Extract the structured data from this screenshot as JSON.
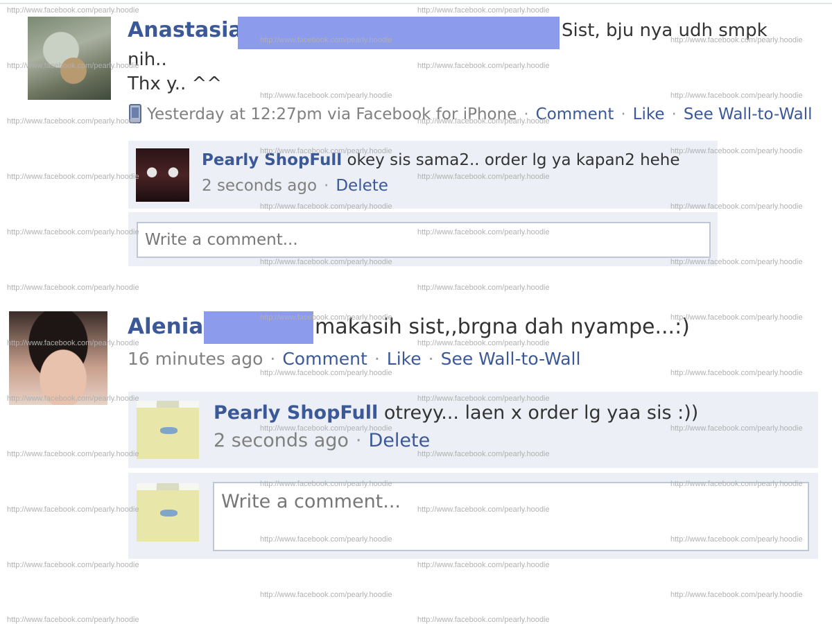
{
  "posts": [
    {
      "author": "Anastasia",
      "text_line1": "Sist, bju nya udh smpk",
      "text_line2": "nih..",
      "text_line3": "Thx y.. ^^",
      "meta": {
        "time": "Yesterday at 12:27pm via Facebook for iPhone",
        "comment": "Comment",
        "like": "Like",
        "wall": "See Wall-to-Wall"
      },
      "reply": {
        "name": "Pearly ShopFull",
        "text": "okey sis sama2.. order lg ya kapan2 hehe",
        "time": "2 seconds ago",
        "delete": "Delete"
      },
      "comment_placeholder": "Write a comment..."
    },
    {
      "author": "Alenia",
      "text_line1": "makasih sist,,brgna dah nyampe...:)",
      "meta": {
        "time": "16 minutes ago",
        "comment": "Comment",
        "like": "Like",
        "wall": "See Wall-to-Wall"
      },
      "reply": {
        "name": "Pearly ShopFull",
        "text": "otreyy... laen x order lg yaa sis :))",
        "time": "2 seconds ago",
        "delete": "Delete"
      },
      "comment_placeholder": "Write a comment..."
    }
  ],
  "watermark": "http://www.facebook.com/pearly.hoodie",
  "colors": {
    "link": "#3b5998",
    "comment_bg": "#eceff5",
    "redaction": "#8c9bec"
  },
  "icons": {
    "mobile": "phone-icon"
  }
}
